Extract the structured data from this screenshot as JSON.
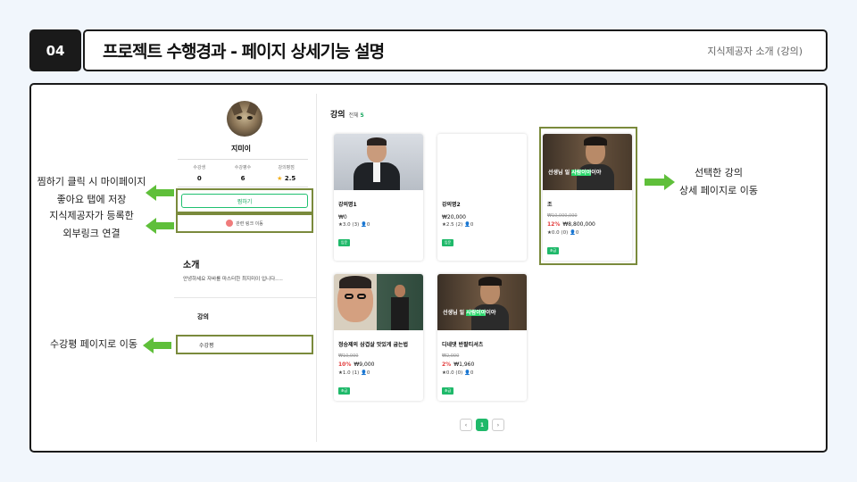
{
  "header": {
    "number": "04",
    "title": "프로젝트 수행경과 - 페이지 상세기능 설명",
    "subtitle": "지식제공자 소개 (강의)"
  },
  "annotations": {
    "like": [
      "찜하기 클릭 시 마이페이지",
      "좋아요 탭에 저장"
    ],
    "link": [
      "지식제공자가 등록한",
      "외부링크 연결"
    ],
    "review": "수강평 페이지로 이동",
    "selected": [
      "선택한 강의",
      "상세 페이지로 이동"
    ]
  },
  "profile": {
    "name": "지미이",
    "stats": [
      {
        "label": "수강생",
        "value": "0"
      },
      {
        "label": "수강평수",
        "value": "6"
      },
      {
        "label": "강의평점",
        "value": "2.5",
        "star": "★"
      }
    ],
    "like_button": "찜하기",
    "link_button": "관련 링크 이동",
    "intro_heading": "소개",
    "intro_text": "안녕하세요 자바를 마스터한 최지미이 입니다.....",
    "lecture_heading": "강의",
    "review_label": "수강평"
  },
  "main": {
    "heading": "강의",
    "total_label": "전체",
    "total_count": "5"
  },
  "cards": [
    {
      "title": "강의명1",
      "price": "₩0",
      "rating": "★3.0 (3) 👤0",
      "tag": "입문"
    },
    {
      "title": "강의명2",
      "price": "₩20,000",
      "rating": "★2.5 (2) 👤0",
      "tag": "입문"
    },
    {
      "title": "조",
      "old_price": "₩10,000,000",
      "discount": "12%",
      "price": "₩8,800,000",
      "rating": "★0.0 (0) 👤0",
      "tag": "초급"
    },
    {
      "title": "정승제의 삼겹살 맛있게 굽는법",
      "old_price": "₩10,000",
      "discount": "10%",
      "price": "₩9,000",
      "rating": "★1.0 (1) 👤0",
      "tag": "초급"
    },
    {
      "title": "디네댓 반팔티셔츠",
      "old_price": "₩2,000",
      "discount": "2%",
      "price": "₩1,960",
      "rating": "★0.0 (0) 👤0",
      "tag": "초급"
    }
  ],
  "thumb_caption": {
    "top": "선생님",
    "highlight": "사람이야",
    "mid": "일 ",
    "tail": "이야"
  },
  "pagination": {
    "prev": "‹",
    "current": "1",
    "next": "›"
  },
  "colors": {
    "accent": "#1fb96a",
    "frame": "#7a8a3c",
    "arrow": "#5fbf3a"
  }
}
